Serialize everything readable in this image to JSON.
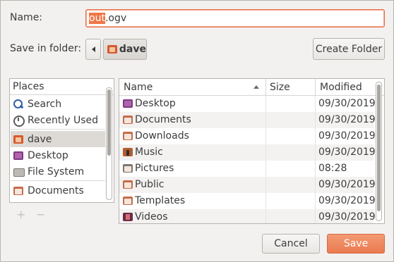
{
  "form": {
    "name_label": "Name:",
    "filename_selected": "out",
    "filename_rest": ".ogv",
    "folder_label": "Save in folder:",
    "current_folder": "dave",
    "create_folder": "Create Folder"
  },
  "places": {
    "header": "Places",
    "items": [
      {
        "label": "Search",
        "icon": "search-icon"
      },
      {
        "label": "Recently Used",
        "icon": "clock-icon"
      },
      {
        "label": "dave",
        "icon": "home-folder-icon",
        "selected": true
      },
      {
        "label": "Desktop",
        "icon": "desktop-folder-icon"
      },
      {
        "label": "File System",
        "icon": "drive-icon"
      },
      {
        "label": "Documents",
        "icon": "folder-icon"
      }
    ],
    "add": "+",
    "remove": "−"
  },
  "files": {
    "columns": {
      "name": "Name",
      "size": "Size",
      "modified": "Modified"
    },
    "rows": [
      {
        "name": "Desktop",
        "modified": "09/30/2019",
        "icon": "desktop-folder-icon"
      },
      {
        "name": "Documents",
        "modified": "09/30/2019",
        "icon": "folder-icon"
      },
      {
        "name": "Downloads",
        "modified": "09/30/2019",
        "icon": "folder-icon"
      },
      {
        "name": "Music",
        "modified": "09/30/2019",
        "icon": "music-folder-icon"
      },
      {
        "name": "Pictures",
        "modified": "08:28",
        "icon": "pictures-folder-icon"
      },
      {
        "name": "Public",
        "modified": "09/30/2019",
        "icon": "folder-icon"
      },
      {
        "name": "Templates",
        "modified": "09/30/2019",
        "icon": "folder-icon"
      },
      {
        "name": "Videos",
        "modified": "09/30/2019",
        "icon": "videos-folder-icon"
      }
    ]
  },
  "actions": {
    "cancel": "Cancel",
    "save": "Save"
  }
}
